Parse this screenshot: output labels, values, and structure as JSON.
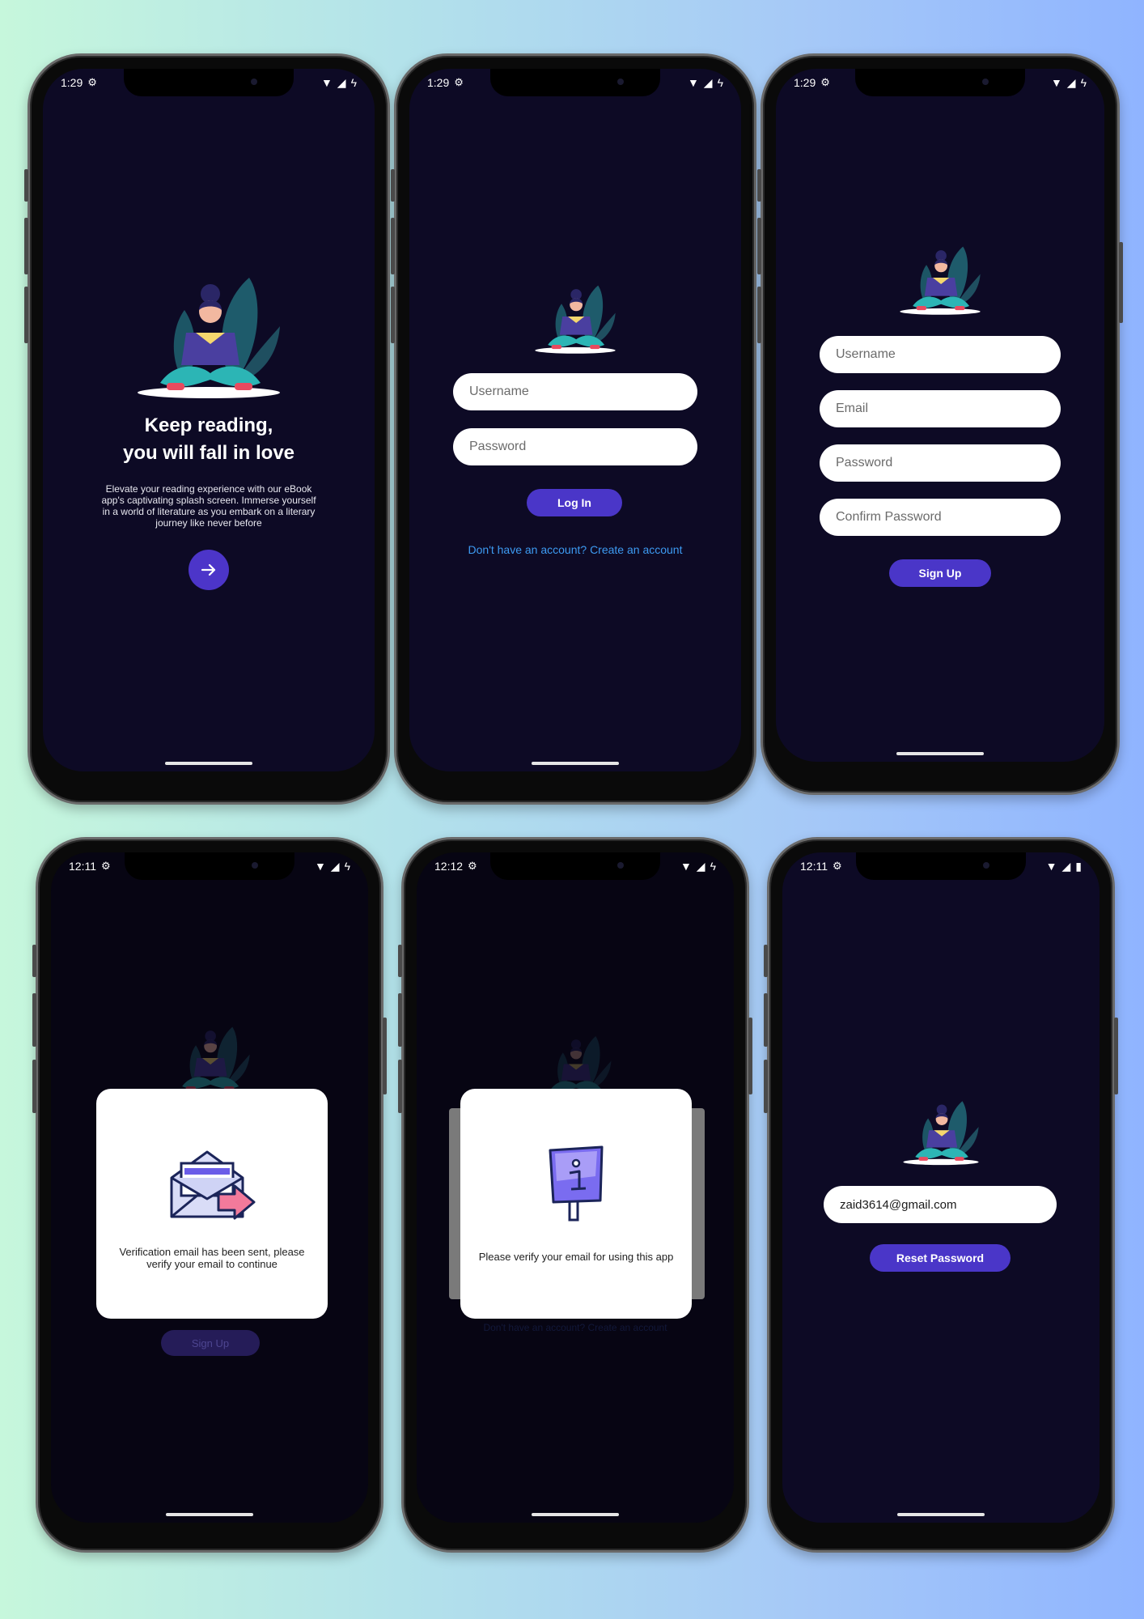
{
  "colors": {
    "screen_bg": "#0d0a25",
    "accent": "#4a36c8",
    "link": "#3d9bf2",
    "input_bg": "#ffffff",
    "modal_bg": "#ffffff"
  },
  "splash": {
    "status_time": "1:29",
    "title_line1": "Keep reading,",
    "title_line2": "you will fall in love",
    "description": "Elevate your reading experience with our eBook app's captivating splash screen. Immerse yourself in a world of literature as you embark on a literary journey like never before",
    "next_icon": "arrow-right-icon"
  },
  "login": {
    "status_time": "1:29",
    "username_placeholder": "Username",
    "password_placeholder": "Password",
    "login_label": "Log In",
    "create_account_link": "Don't have an account? Create an account"
  },
  "signup": {
    "status_time": "1:29",
    "username_placeholder": "Username",
    "email_placeholder": "Email",
    "password_placeholder": "Password",
    "confirm_placeholder": "Confirm Password",
    "signup_label": "Sign Up"
  },
  "verification_sent": {
    "status_time": "12:11",
    "icon": "envelope-send-icon",
    "message": "Verification email has been sent, please verify your email to continue",
    "background_button": "Sign Up"
  },
  "verify_prompt": {
    "status_time": "12:12",
    "icon": "info-sign-icon",
    "message": "Please verify your email for using this app",
    "background_link": "Don't have an account? Create an account"
  },
  "reset": {
    "status_time": "12:11",
    "email_value": "zaid3614@gmail.com",
    "reset_label": "Reset Password"
  }
}
